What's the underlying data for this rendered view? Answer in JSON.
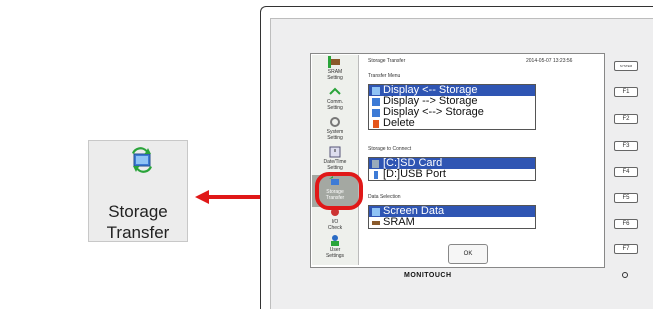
{
  "callout": {
    "label_line1": "Storage",
    "label_line2": "Transfer",
    "icon": "storage-transfer-icon"
  },
  "screen": {
    "title": "Storage Transfer",
    "datetime": "2014-05-07 13:23:56",
    "sidebar": [
      {
        "label1": "SRAM",
        "label2": "Setting",
        "icon": "sram-icon"
      },
      {
        "label1": "Comm.",
        "label2": "Setting",
        "icon": "comm-icon"
      },
      {
        "label1": "System",
        "label2": "Setting",
        "icon": "system-icon"
      },
      {
        "label1": "Date/Time",
        "label2": "Setting",
        "icon": "clock-icon"
      },
      {
        "label1": "Storage",
        "label2": "Transfer",
        "icon": "storage-transfer-icon"
      },
      {
        "label1": "I/O",
        "label2": "Check",
        "icon": "io-icon"
      },
      {
        "label1": "User",
        "label2": "Settings",
        "icon": "user-icon"
      }
    ],
    "transfer_menu": {
      "heading": "Transfer Menu",
      "items": [
        {
          "label": "Display <-- Storage",
          "selected": true
        },
        {
          "label": "Display --> Storage",
          "selected": false
        },
        {
          "label": "Display <--> Storage",
          "selected": false
        },
        {
          "label": "Delete",
          "selected": false
        }
      ]
    },
    "storage_connect": {
      "heading": "Storage to Connect",
      "items": [
        {
          "label": "[C:]SD Card",
          "selected": true
        },
        {
          "label": "[D:]USB Port",
          "selected": false
        }
      ]
    },
    "data_selection": {
      "heading": "Data Selection",
      "items": [
        {
          "label": "Screen Data",
          "selected": true
        },
        {
          "label": "SRAM",
          "selected": false
        }
      ]
    },
    "ok_label": "OK"
  },
  "device": {
    "system_label": "SYSTEM",
    "fkeys": [
      "F1",
      "F2",
      "F3",
      "F4",
      "F5",
      "F6",
      "F7"
    ],
    "brand": "MONITOUCH"
  },
  "colors": {
    "highlight": "#e01818",
    "selection": "#2f55b3"
  }
}
